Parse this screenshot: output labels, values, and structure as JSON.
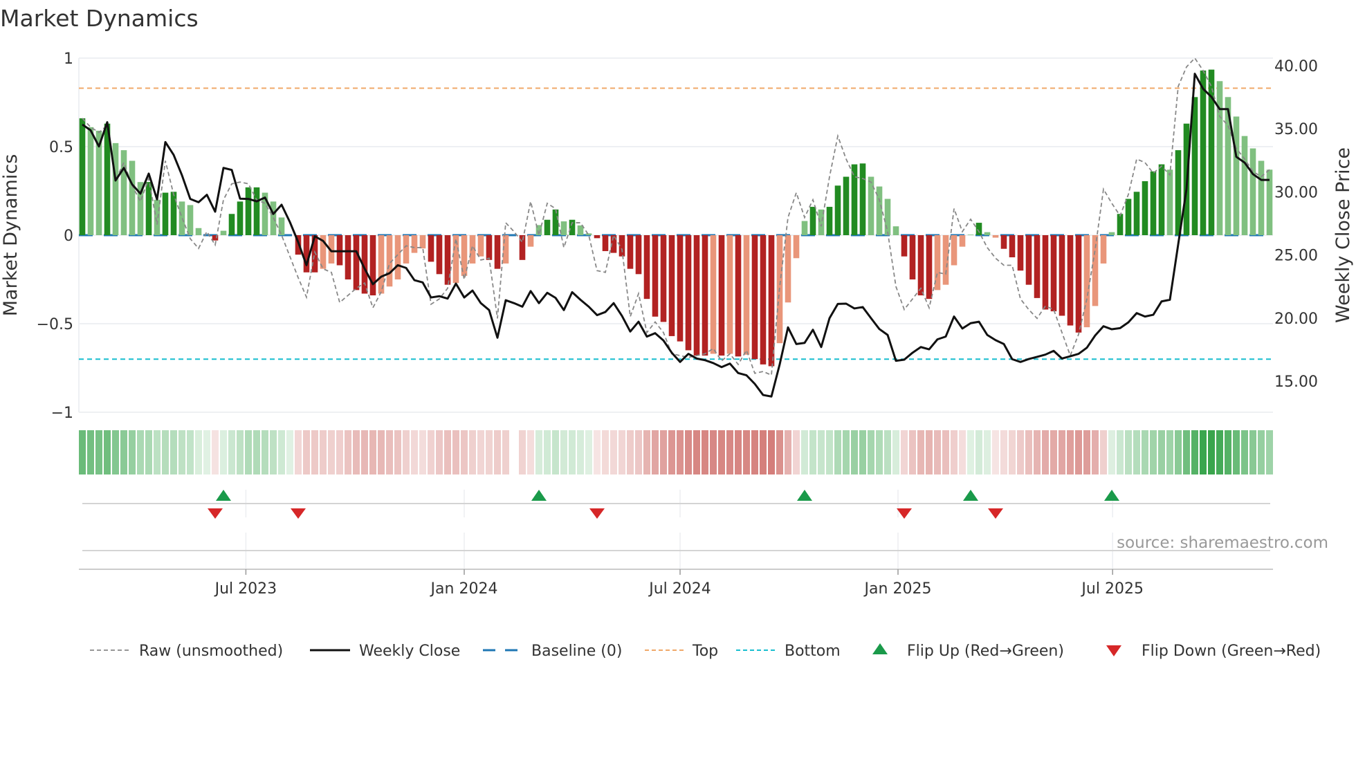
{
  "title": "Market Dynamics",
  "source": "source: sharemaestro.com",
  "colors": {
    "bar_strong_pos": "#228b22",
    "bar_weak_pos": "#80c080",
    "bar_strong_neg": "#b22222",
    "bar_weak_neg": "#e9967a",
    "close": "#111111",
    "raw": "#888888",
    "baseline": "#1f77b4",
    "top": "#f0a868",
    "bottom": "#17becf",
    "flip_up": "#1a9a4a",
    "flip_down": "#d62728",
    "grid": "#eef0f3"
  },
  "legend": [
    {
      "key": "raw",
      "label": "Raw (unsmoothed)"
    },
    {
      "key": "close",
      "label": "Weekly Close"
    },
    {
      "key": "baseline",
      "label": "Baseline (0)"
    },
    {
      "key": "top",
      "label": "Top"
    },
    {
      "key": "bottom",
      "label": "Bottom"
    },
    {
      "key": "flip_up",
      "label": "Flip Up (Red→Green)"
    },
    {
      "key": "flip_down",
      "label": "Flip Down (Green→Red)"
    }
  ],
  "chart_data": {
    "type": "bar",
    "title": "Market Dynamics",
    "ylabel": "Market Dynamics",
    "y2label": "Weekly Close Price",
    "ylim": [
      -1,
      1
    ],
    "y2lim": [
      12.5,
      41.3
    ],
    "xlim_weeks": [
      0,
      143
    ],
    "yticks": [
      {
        "v": 1,
        "label": "1"
      },
      {
        "v": 0.5,
        "label": "0.5"
      },
      {
        "v": 0,
        "label": "0"
      },
      {
        "v": -0.5,
        "label": "−0.5"
      },
      {
        "v": -1,
        "label": "−1"
      }
    ],
    "y2ticks": [
      {
        "v": 40,
        "label": "40.00"
      },
      {
        "v": 35,
        "label": "35.00"
      },
      {
        "v": 30,
        "label": "30.00"
      },
      {
        "v": 25,
        "label": "25.00"
      },
      {
        "v": 20,
        "label": "20.00"
      },
      {
        "v": 15,
        "label": "15.00"
      }
    ],
    "xticks": [
      {
        "week": 19.7,
        "label": "Jul 2023"
      },
      {
        "week": 46.0,
        "label": "Jan 2024"
      },
      {
        "week": 72.0,
        "label": "Jul 2024"
      },
      {
        "week": 98.25,
        "label": "Jan 2025"
      },
      {
        "week": 124.1,
        "label": "Jul 2025"
      }
    ],
    "top_level": 0.83,
    "bottom_level": -0.7,
    "baseline": 0,
    "grid": true,
    "legend_position": "bottom",
    "dynamics": [
      0.66,
      0.61,
      0.59,
      0.63,
      0.52,
      0.48,
      0.42,
      0.3,
      0.3,
      0.2,
      0.24,
      0.245,
      0.19,
      0.17,
      0.04,
      0,
      -0.03,
      0.025,
      0.12,
      0.19,
      0.27,
      0.27,
      0.24,
      0.19,
      0.1,
      0,
      -0.11,
      -0.21,
      -0.21,
      -0.19,
      -0.16,
      -0.17,
      -0.25,
      -0.31,
      -0.33,
      -0.34,
      -0.33,
      -0.29,
      -0.25,
      -0.16,
      -0.1,
      -0.075,
      -0.15,
      -0.22,
      -0.28,
      -0.27,
      -0.23,
      -0.16,
      -0.12,
      -0.14,
      -0.19,
      -0.16,
      null,
      -0.14,
      -0.065,
      0.057,
      0.087,
      0.145,
      0.078,
      0.087,
      0.055,
      0.01,
      -0.017,
      -0.09,
      -0.1,
      -0.12,
      -0.19,
      -0.22,
      -0.36,
      -0.46,
      -0.49,
      -0.57,
      -0.6,
      -0.65,
      -0.68,
      -0.68,
      -0.67,
      -0.68,
      -0.67,
      -0.685,
      -0.675,
      -0.7,
      -0.73,
      -0.74,
      -0.61,
      -0.38,
      -0.13,
      0.08,
      0.16,
      0.145,
      0.16,
      0.28,
      0.33,
      0.4,
      0.405,
      0.33,
      0.275,
      0.205,
      0.05,
      -0.12,
      -0.25,
      -0.34,
      -0.36,
      -0.31,
      -0.28,
      -0.17,
      -0.065,
      0.003,
      0.07,
      0.017,
      -0.014,
      -0.077,
      -0.125,
      -0.2,
      -0.28,
      -0.355,
      -0.42,
      -0.43,
      -0.455,
      -0.51,
      -0.55,
      -0.52,
      -0.4,
      -0.16,
      0.017,
      0.12,
      0.205,
      0.245,
      0.305,
      0.36,
      0.4,
      0.37,
      0.48,
      0.63,
      0.78,
      0.93,
      0.935,
      0.87,
      0.78,
      0.67,
      0.56,
      0.49,
      0.42,
      0.37
    ],
    "raw": [
      0.66,
      0.61,
      0.58,
      0.62,
      0.31,
      0.41,
      0.28,
      0.19,
      0.32,
      0.06,
      0.42,
      0.23,
      0.1,
      -0.02,
      -0.075,
      0.02,
      -0.055,
      0.2,
      0.29,
      0.3,
      0.29,
      0.2,
      0.18,
      0.1,
      0.0,
      -0.12,
      -0.24,
      -0.35,
      -0.095,
      -0.19,
      -0.21,
      -0.38,
      -0.34,
      -0.3,
      -0.27,
      -0.41,
      -0.32,
      -0.16,
      -0.11,
      -0.06,
      -0.07,
      -0.07,
      -0.39,
      -0.36,
      -0.3,
      -0.02,
      -0.25,
      -0.06,
      -0.14,
      -0.13,
      -0.47,
      0.07,
      0.02,
      -0.04,
      0.19,
      0.0,
      0.18,
      0.15,
      -0.07,
      0.07,
      0.07,
      0.0,
      -0.2,
      -0.21,
      0.0,
      -0.08,
      -0.46,
      -0.33,
      -0.55,
      -0.49,
      -0.55,
      -0.67,
      -0.68,
      -0.69,
      -0.68,
      -0.67,
      -0.64,
      -0.71,
      -0.67,
      -0.73,
      -0.65,
      -0.78,
      -0.77,
      -0.79,
      -0.29,
      0.1,
      0.24,
      0.1,
      0.2,
      0.05,
      0.33,
      0.56,
      0.43,
      0.33,
      0.32,
      0.3,
      0.2,
      0.02,
      -0.29,
      -0.42,
      -0.36,
      -0.3,
      -0.41,
      -0.21,
      -0.22,
      0.15,
      0.02,
      0.09,
      0.02,
      -0.07,
      -0.13,
      -0.17,
      -0.17,
      -0.36,
      -0.42,
      -0.47,
      -0.4,
      -0.42,
      -0.55,
      -0.68,
      -0.56,
      -0.36,
      -0.08,
      0.26,
      0.18,
      0.11,
      0.23,
      0.43,
      0.41,
      0.35,
      0.39,
      0.34,
      0.84,
      0.95,
      1.0,
      0.93,
      0.84,
      0.67,
      0.62,
      0.49,
      0.43,
      0.36,
      0.33,
      0.37
    ],
    "weekly_close": [
      35.34,
      34.88,
      33.6,
      35.52,
      30.9,
      31.9,
      30.59,
      29.86,
      31.45,
      29.4,
      33.95,
      32.93,
      31.32,
      29.44,
      29.18,
      29.77,
      28.43,
      31.9,
      31.74,
      29.46,
      29.44,
      29.25,
      29.55,
      28.25,
      28.98,
      27.61,
      26.02,
      24.19,
      26.48,
      26.11,
      25.29,
      25.29,
      25.29,
      25.29,
      23.92,
      22.68,
      23.28,
      23.55,
      24.19,
      23.97,
      23.0,
      22.82,
      21.63,
      21.73,
      21.54,
      22.73,
      21.63,
      22.18,
      21.18,
      20.63,
      18.44,
      21.41,
      21.18,
      20.9,
      22.14,
      21.18,
      22.0,
      21.6,
      20.63,
      22.05,
      21.45,
      20.9,
      20.23,
      20.48,
      21.18,
      20.17,
      18.93,
      19.71,
      18.53,
      18.8,
      18.22,
      17.25,
      16.52,
      17.16,
      16.79,
      16.66,
      16.43,
      16.11,
      16.39,
      15.64,
      15.46,
      14.78,
      13.9,
      13.78,
      16.33,
      19.26,
      17.94,
      18.03,
      19.07,
      17.7,
      19.99,
      21.12,
      21.14,
      20.76,
      20.87,
      19.99,
      19.13,
      18.66,
      16.61,
      16.7,
      17.25,
      17.7,
      17.52,
      18.31,
      18.53,
      20.12,
      19.17,
      19.59,
      19.71,
      18.66,
      18.25,
      17.94,
      16.74,
      16.52,
      16.75,
      16.92,
      17.1,
      17.4,
      16.79,
      16.97,
      17.16,
      17.65,
      18.62,
      19.35,
      19.11,
      19.2,
      19.66,
      20.39,
      20.12,
      20.26,
      21.32,
      21.45,
      25.84,
      30.22,
      39.36,
      38.17,
      37.53,
      36.56,
      36.56,
      32.78,
      32.32,
      31.41,
      30.95,
      30.95
    ],
    "flip_up_weeks": [
      17,
      55,
      87,
      107,
      124
    ],
    "flip_down_weeks": [
      16,
      26,
      62,
      99,
      110
    ]
  }
}
